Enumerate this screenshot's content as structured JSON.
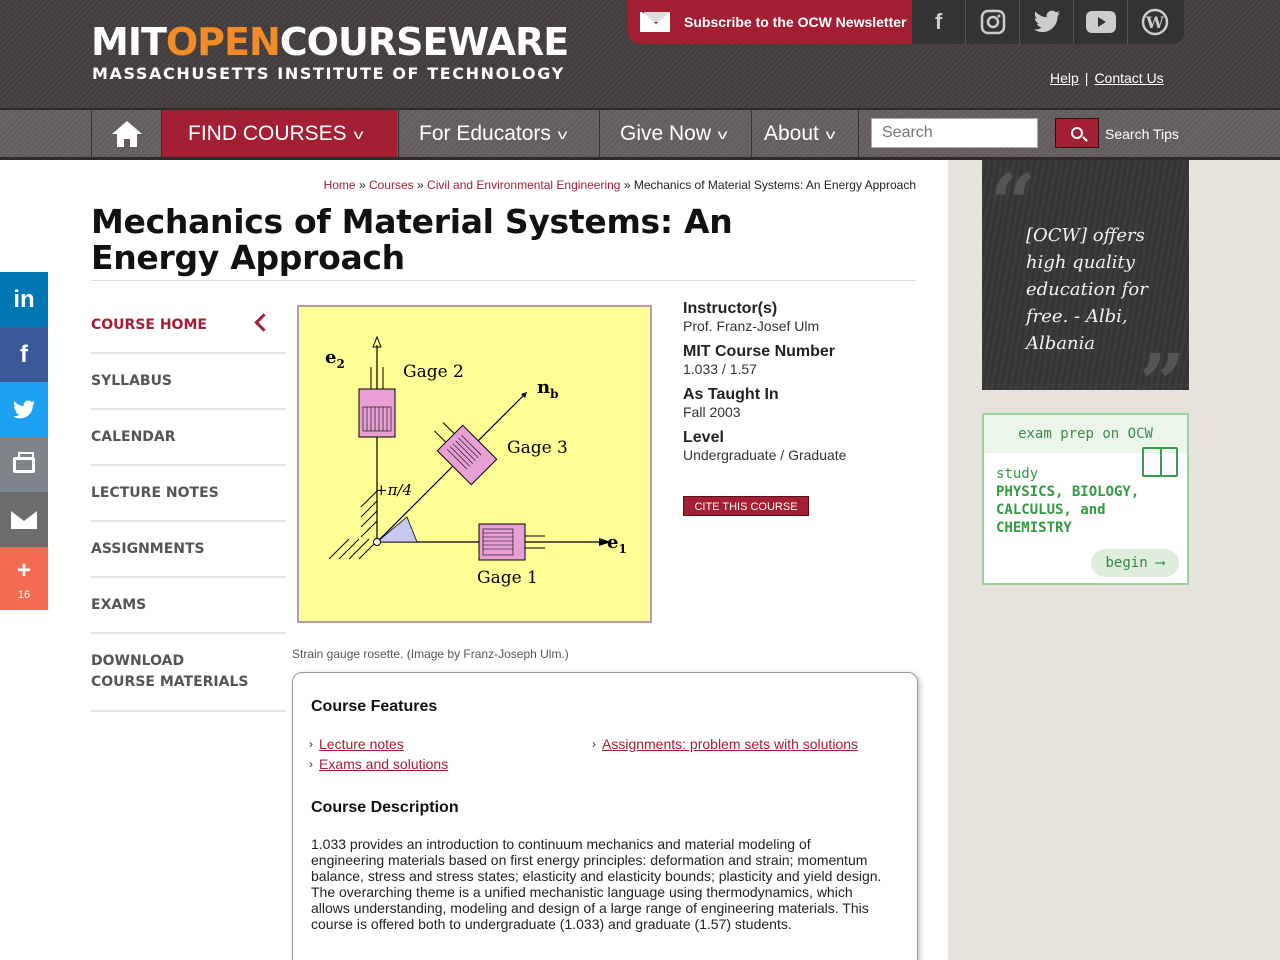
{
  "header": {
    "logo_mit": "MIT",
    "logo_open": "OPEN",
    "logo_courseware": "COURSEWARE",
    "logo_sub": "MASSACHUSETTS INSTITUTE OF TECHNOLOGY",
    "newsletter_label": "Subscribe to the OCW Newsletter",
    "socials": [
      "facebook-icon",
      "instagram-icon",
      "twitter-icon",
      "youtube-icon",
      "wordpress-icon"
    ],
    "help_link": "Help",
    "contact_link": "Contact Us"
  },
  "nav": {
    "find_courses": "FIND COURSES",
    "for_educators": "For Educators",
    "give_now": "Give Now",
    "about": "About",
    "search_placeholder": "Search",
    "search_tips": "Search Tips"
  },
  "breadcrumb": {
    "home": "Home",
    "courses": "Courses",
    "department": "Civil and Environmental Engineering",
    "current": "Mechanics of Material Systems: An Energy Approach",
    "sep": "»"
  },
  "page": {
    "title": "Mechanics of Material Systems: An Energy Approach"
  },
  "leftnav": {
    "items": [
      {
        "label": "COURSE HOME"
      },
      {
        "label": "SYLLABUS"
      },
      {
        "label": "CALENDAR"
      },
      {
        "label": "LECTURE NOTES"
      },
      {
        "label": "ASSIGNMENTS"
      },
      {
        "label": "EXAMS"
      },
      {
        "label": "DOWNLOAD COURSE MATERIALS"
      }
    ]
  },
  "figure": {
    "caption": "Strain gauge rosette. (Image by Franz-Joseph Ulm.)",
    "labels": {
      "e2": "e",
      "e2_sub": "2",
      "e1": "e",
      "e1_sub": "1",
      "nb": "n",
      "nb_sub": "b",
      "gage1": "Gage 1",
      "gage2": "Gage 2",
      "gage3": "Gage 3",
      "angle": "+π/4"
    },
    "colors": {
      "background": "#fefd96",
      "gage": "#e9a0d4"
    }
  },
  "info": {
    "instructors_label": "Instructor(s)",
    "instructors_value": "Prof. Franz-Josef Ulm",
    "number_label": "MIT Course Number",
    "number_value": "1.033 / 1.57",
    "taught_label": "As Taught In",
    "taught_value": "Fall 2003",
    "level_label": "Level",
    "level_value": "Undergraduate / Graduate",
    "cite_button": "CITE THIS COURSE"
  },
  "features": {
    "heading": "Course Features",
    "links": [
      "Lecture notes",
      "Assignments: problem sets with solutions",
      "Exams and solutions"
    ],
    "desc_heading": "Course Description",
    "description": "1.033 provides an introduction to continuum mechanics and material modeling of engineering materials based on first energy principles: deformation and strain; momentum balance, stress and stress states; elasticity and elasticity bounds; plasticity and yield design. The overarching theme is a unified mechanistic language using thermodynamics, which allows understanding, modeling and design of a large range of engineering materials. This course is offered both to undergraduate (1.033) and graduate (1.57) students."
  },
  "share": {
    "count": "16"
  },
  "sidebar": {
    "quote": "[OCW] offers high quality education for free. - Albi, Albania",
    "prep_head": "exam prep on OCW",
    "prep_study": "study",
    "prep_subjects": "PHYSICS, BIOLOGY, CALCULUS, and CHEMISTRY",
    "begin": "begin ⟶"
  },
  "colors": {
    "accent": "#a31f34",
    "orange": "#f28c28"
  }
}
